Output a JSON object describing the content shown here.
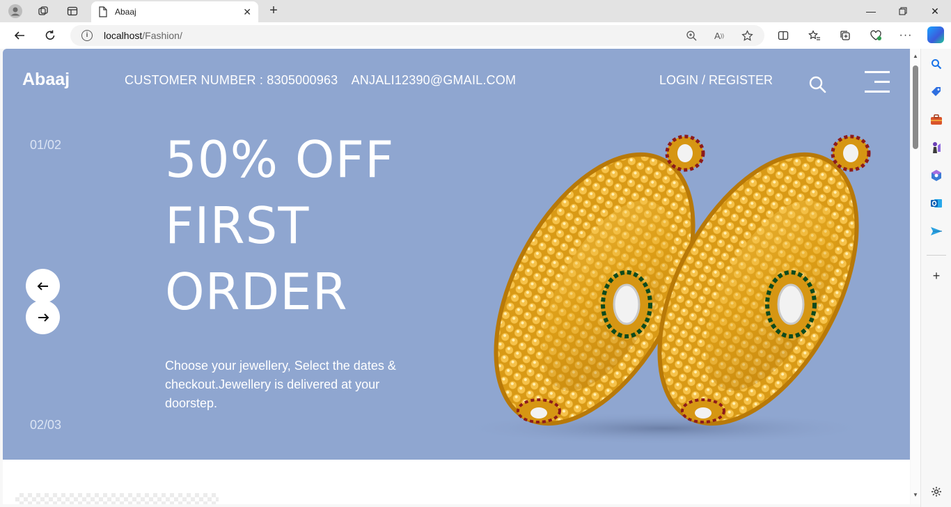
{
  "browser": {
    "tab_title": "Abaaj",
    "url_host": "localhost",
    "url_path": "/Fashion/"
  },
  "site": {
    "logo": "Abaaj",
    "customer_number": "CUSTOMER NUMBER : 8305000963",
    "email": "ANJALI12390@GMAIL.COM",
    "login_register": "LOGIN / REGISTER"
  },
  "hero": {
    "counter_top": "01/02",
    "counter_bottom": "02/03",
    "headline_line1": "50% OFF",
    "headline_line2": "FIRST",
    "headline_line3": "ORDER",
    "description": "Choose your jewellery, Select the dates & checkout.Jewellery is delivered at your doorstep.",
    "background_color": "#8fa6d0"
  },
  "icons": {
    "prev": "arrow-left-icon",
    "next": "arrow-right-icon",
    "search": "search-icon",
    "menu": "hamburger-menu-icon"
  }
}
